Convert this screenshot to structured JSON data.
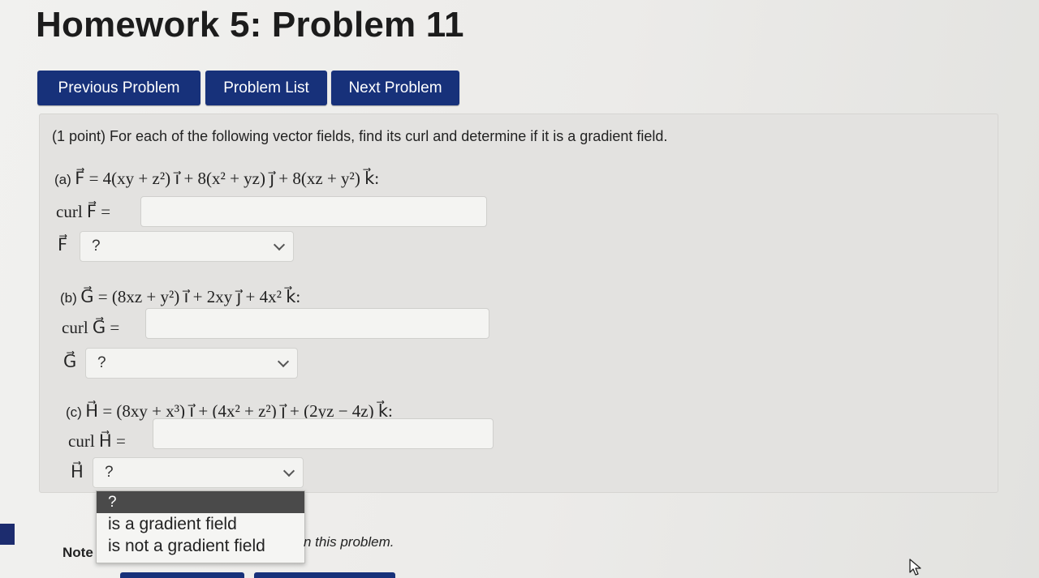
{
  "header": {
    "title": "Homework 5: Problem 11"
  },
  "nav": {
    "previous_label": "Previous Problem",
    "list_label": "Problem List",
    "next_label": "Next Problem"
  },
  "problem": {
    "intro": "(1 point) For each of the following vector fields, find its curl and determine if it is a gradient field.",
    "parts": [
      {
        "label": "(a)",
        "field": "F⃗ = 4(xy + z²) i⃗ + 8(x² + yz) j⃗ + 8(xz + y²) k⃗:",
        "curl_label": "curl F⃗ =",
        "curl_value": "",
        "select_prefix": "F⃗",
        "select_value": "?"
      },
      {
        "label": "(b)",
        "field": "G⃗ = (8xz + y²) i⃗ + 2xy j⃗ + 4x² k⃗:",
        "curl_label": "curl G⃗ =",
        "curl_value": "",
        "select_prefix": "G⃗",
        "select_value": "?"
      },
      {
        "label": "(c)",
        "field": "H⃗ = (8xy + x³) i⃗ + (4x² + z²) j⃗ + (2yz − 4z) k⃗:",
        "curl_label": "curl H⃗ =",
        "curl_value": "",
        "select_prefix": "H⃗",
        "select_value": "?"
      }
    ],
    "dropdown_options": [
      "?",
      "is a gradient field",
      "is not a gradient field"
    ]
  },
  "note": {
    "bold": "Note",
    "tail": "n this problem."
  },
  "colors": {
    "nav_button": "#17317a",
    "dropdown_selected": "#4a4a4a"
  }
}
